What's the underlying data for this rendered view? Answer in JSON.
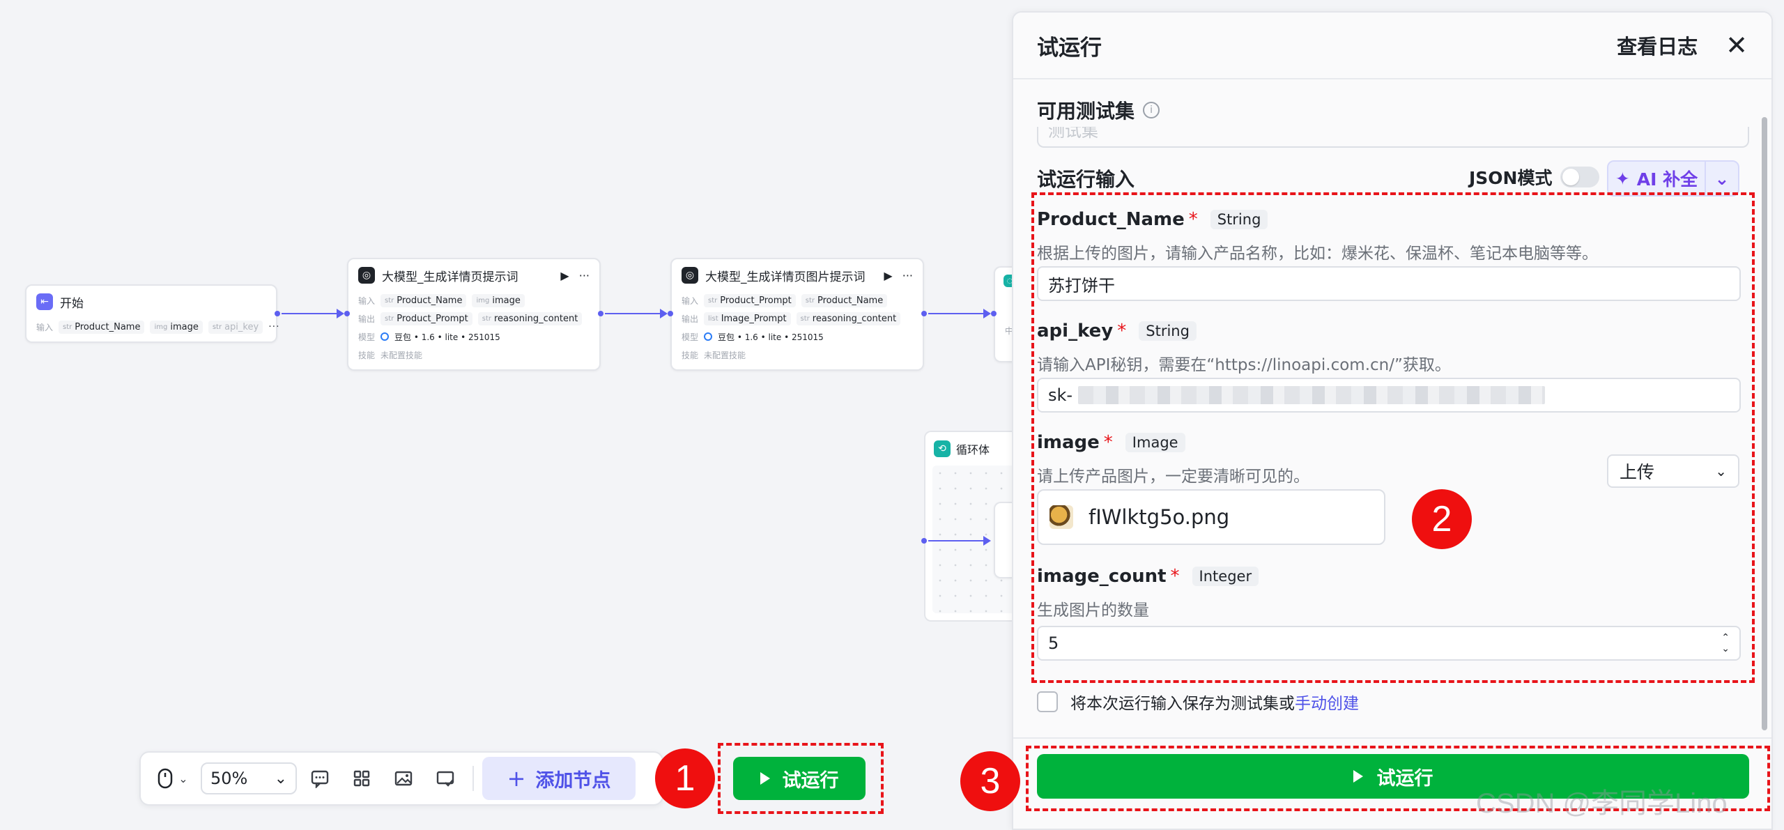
{
  "canvas": {
    "start_node": {
      "title": "开始",
      "input_label": "输入",
      "params": [
        {
          "type": "str",
          "name": "Product_Name"
        },
        {
          "type": "img",
          "name": "image"
        },
        {
          "type": "str",
          "name": "api_key"
        }
      ]
    },
    "llm_node_1": {
      "title": "大模型_生成详情页提示词",
      "input_label": "输入",
      "inputs": [
        {
          "type": "str",
          "name": "Product_Name"
        },
        {
          "type": "img",
          "name": "image"
        }
      ],
      "output_label": "输出",
      "outputs": [
        {
          "type": "str",
          "name": "Product_Prompt"
        },
        {
          "type": "str",
          "name": "reasoning_content"
        }
      ],
      "model_label": "模型",
      "model": "豆包 • 1.6 • lite • 251015",
      "skill_label": "技能",
      "skill": "未配置技能"
    },
    "llm_node_2": {
      "title": "大模型_生成详情页图片提示词",
      "input_label": "输入",
      "inputs": [
        {
          "type": "str",
          "name": "Product_Prompt"
        },
        {
          "type": "str",
          "name": "Product_Name"
        }
      ],
      "output_label": "输出",
      "outputs": [
        {
          "type": "list",
          "name": "Image_Prompt"
        },
        {
          "type": "str",
          "name": "reasoning_content"
        }
      ],
      "model_label": "模型",
      "model": "豆包 • 1.6 • lite • 251015",
      "skill_label": "技能",
      "skill": "未配置技能"
    },
    "partial_node": {
      "label": "中"
    },
    "loop_node": {
      "title": "循环体"
    }
  },
  "toolbar": {
    "zoom": "50%",
    "add_node_label": "添加节点",
    "run_label": "试运行"
  },
  "panel": {
    "title": "试运行",
    "log_label": "查看日志",
    "testset_title": "可用测试集",
    "testset_placeholder": "测试集",
    "run_input_title": "试运行输入",
    "json_mode_label": "JSON模式",
    "ai_fill_label": "AI 补全",
    "fields": [
      {
        "name": "Product_Name",
        "type": "String",
        "desc": "根据上传的图片，请输入产品名称，比如：爆米花、保温杯、笔记本电脑等等。",
        "value": "苏打饼干"
      },
      {
        "name": "api_key",
        "type": "String",
        "desc": "请输入API秘钥，需要在“https://linoapi.com.cn/”获取。",
        "value": "sk-"
      },
      {
        "name": "image",
        "type": "Image",
        "desc": "请上传产品图片，一定要清晰可见的。",
        "upload_mode": "上传",
        "file_name": "fIWlktg5o.png"
      },
      {
        "name": "image_count",
        "type": "Integer",
        "desc": "生成图片的数量",
        "value": "5"
      }
    ],
    "save_text": "将本次运行输入保存为测试集或",
    "save_link": "手动创建",
    "run_label": "试运行"
  },
  "annotations": {
    "badge_1": "1",
    "badge_2": "2",
    "badge_3": "3"
  },
  "watermark": "CSDN @李同学Lino",
  "colors": {
    "accent": "#5d5ff0",
    "run_green": "#00b23c",
    "annotation_red": "#e8141a"
  }
}
